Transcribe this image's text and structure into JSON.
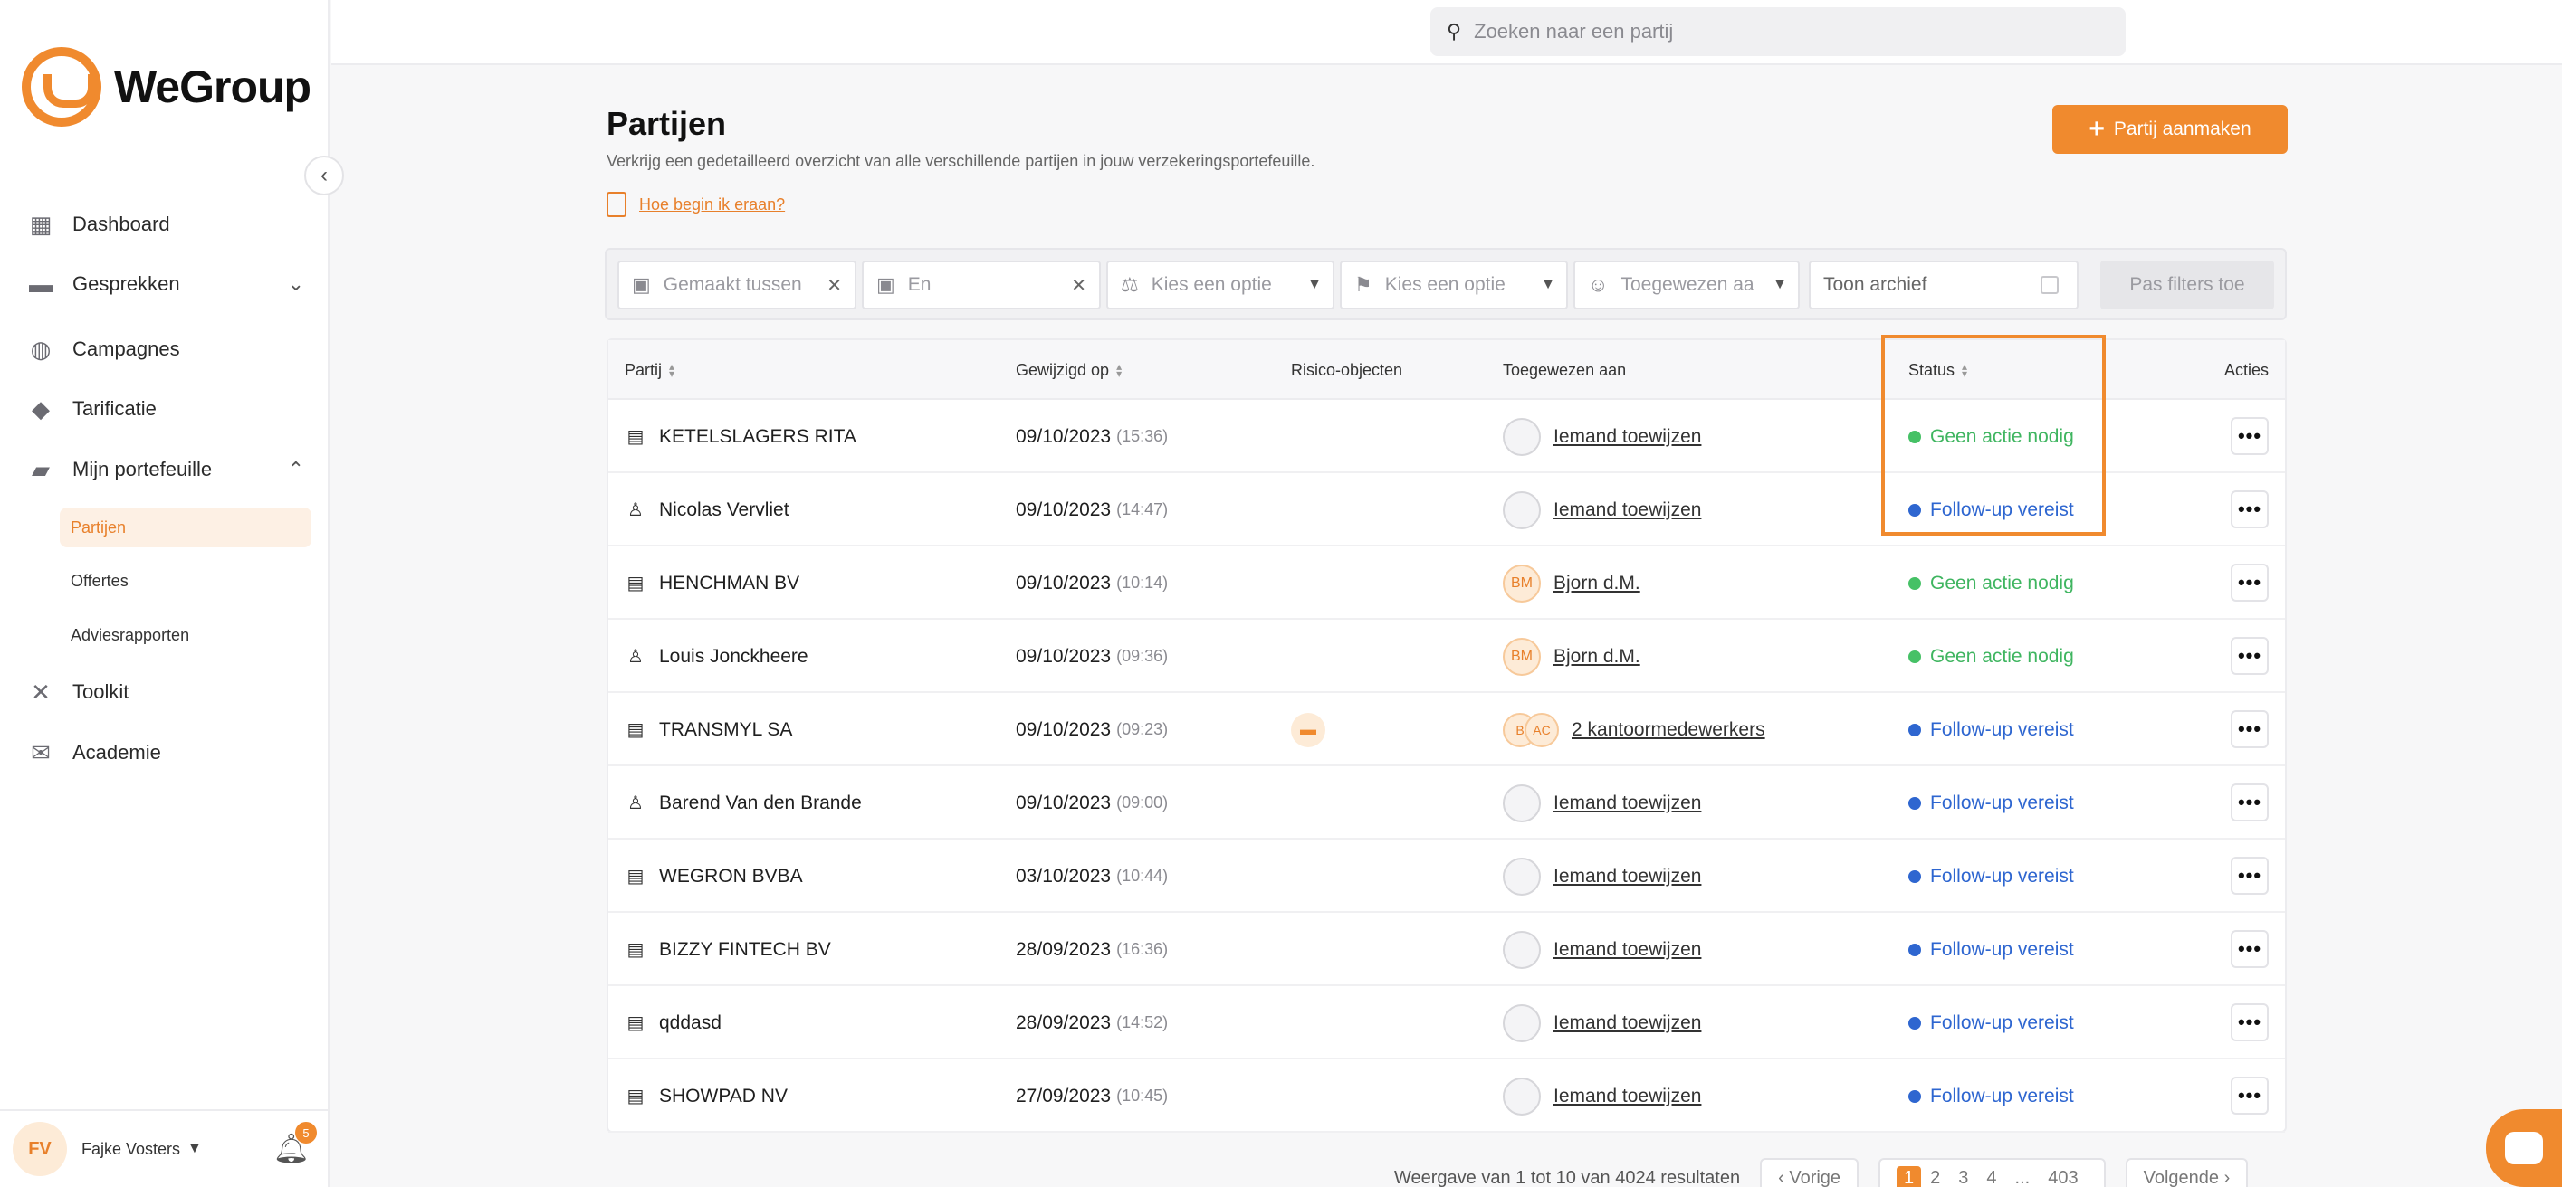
{
  "app": {
    "logo_text": "WeGroup"
  },
  "search": {
    "placeholder": "Zoeken naar een partij"
  },
  "sidebar": {
    "items": [
      {
        "label": "Dashboard",
        "icon": "grid-icon"
      },
      {
        "label": "Gesprekken",
        "icon": "chat-icon"
      },
      {
        "label": "Campagnes",
        "icon": "globe-icon"
      },
      {
        "label": "Tarificatie",
        "icon": "piggybank-icon"
      },
      {
        "label": "Mijn portefeuille",
        "icon": "folder-icon"
      },
      {
        "label": "Toolkit",
        "icon": "tools-icon"
      },
      {
        "label": "Academie",
        "icon": "mail-icon"
      }
    ],
    "sub_items": [
      {
        "label": "Partijen",
        "active": true
      },
      {
        "label": "Offertes",
        "active": false
      },
      {
        "label": "Adviesrapporten",
        "active": false
      }
    ]
  },
  "user": {
    "initials": "FV",
    "name": "Fajke Vosters",
    "notifications": "5"
  },
  "page": {
    "title": "Partijen",
    "subtitle": "Verkrijg een gedetailleerd overzicht van alle verschillende partijen in jouw verzekeringsportefeuille.",
    "help_link": "Hoe begin ik eraan?",
    "create_button": "Partij aanmaken"
  },
  "filters": {
    "created_between": "Gemaakt tussen",
    "and": "En",
    "option1": "Kies een optie",
    "option2": "Kies een optie",
    "assigned": "Toegewezen aa",
    "archive": "Toon archief",
    "apply": "Pas filters toe"
  },
  "table": {
    "headers": {
      "party": "Partij",
      "modified": "Gewijzigd op",
      "risk": "Risico-objecten",
      "assigned": "Toegewezen aan",
      "status": "Status",
      "actions": "Acties"
    },
    "rows": [
      {
        "type": "company",
        "name": "KETELSLAGERS RITA",
        "date": "09/10/2023",
        "time": "(15:36)",
        "risk": "",
        "assignee_initials": "",
        "assignee": "Iemand toewijzen",
        "status": "Geen actie nodig",
        "status_color": "green"
      },
      {
        "type": "person",
        "name": "Nicolas Vervliet",
        "date": "09/10/2023",
        "time": "(14:47)",
        "risk": "",
        "assignee_initials": "",
        "assignee": "Iemand toewijzen",
        "status": "Follow-up vereist",
        "status_color": "blue"
      },
      {
        "type": "company",
        "name": "HENCHMAN BV",
        "date": "09/10/2023",
        "time": "(10:14)",
        "risk": "",
        "assignee_initials": "BM",
        "assignee": "Bjorn d.M.",
        "status": "Geen actie nodig",
        "status_color": "green"
      },
      {
        "type": "person",
        "name": "Louis Jonckheere",
        "date": "09/10/2023",
        "time": "(09:36)",
        "risk": "",
        "assignee_initials": "BM",
        "assignee": "Bjorn d.M.",
        "status": "Geen actie nodig",
        "status_color": "green"
      },
      {
        "type": "company",
        "name": "TRANSMYL SA",
        "date": "09/10/2023",
        "time": "(09:23)",
        "risk": "car-icon",
        "assignee_initials": "B|AC",
        "assignee": "2 kantoormedewerkers",
        "status": "Follow-up vereist",
        "status_color": "blue"
      },
      {
        "type": "person",
        "name": "Barend Van den Brande",
        "date": "09/10/2023",
        "time": "(09:00)",
        "risk": "",
        "assignee_initials": "",
        "assignee": "Iemand toewijzen",
        "status": "Follow-up vereist",
        "status_color": "blue"
      },
      {
        "type": "company",
        "name": "WEGRON BVBA",
        "date": "03/10/2023",
        "time": "(10:44)",
        "risk": "",
        "assignee_initials": "",
        "assignee": "Iemand toewijzen",
        "status": "Follow-up vereist",
        "status_color": "blue"
      },
      {
        "type": "company",
        "name": "BIZZY FINTECH BV",
        "date": "28/09/2023",
        "time": "(16:36)",
        "risk": "",
        "assignee_initials": "",
        "assignee": "Iemand toewijzen",
        "status": "Follow-up vereist",
        "status_color": "blue"
      },
      {
        "type": "company",
        "name": "qddasd",
        "date": "28/09/2023",
        "time": "(14:52)",
        "risk": "",
        "assignee_initials": "",
        "assignee": "Iemand toewijzen",
        "status": "Follow-up vereist",
        "status_color": "blue"
      },
      {
        "type": "company",
        "name": "SHOWPAD NV",
        "date": "27/09/2023",
        "time": "(10:45)",
        "risk": "",
        "assignee_initials": "",
        "assignee": "Iemand toewijzen",
        "status": "Follow-up vereist",
        "status_color": "blue"
      }
    ]
  },
  "pagination": {
    "summary": "Weergave van 1 tot 10 van 4024 resultaten",
    "prev": "Vorige",
    "pages": [
      "1",
      "2",
      "3",
      "4",
      "...",
      "403"
    ],
    "current": "1",
    "next": "Volgende"
  },
  "colors": {
    "accent": "#f08a2e",
    "green": "#46c166",
    "blue": "#2e66d0"
  }
}
